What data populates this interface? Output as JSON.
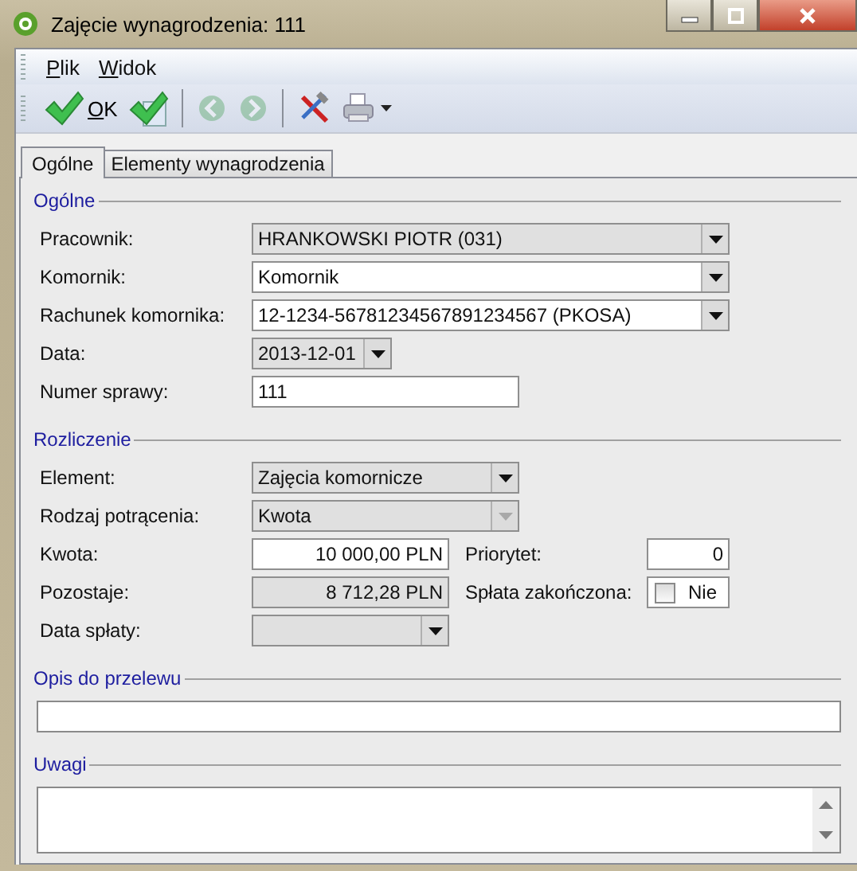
{
  "window": {
    "title": "Zajęcie wynagrodzenia: 111"
  },
  "menu": [
    {
      "key": "P",
      "rest": "lik"
    },
    {
      "key": "W",
      "rest": "idok"
    }
  ],
  "toolbar": [
    {
      "kind": "ok",
      "key": "O",
      "rest": "K",
      "disabled": false
    },
    {
      "kind": "save-new",
      "disabled": false
    },
    {
      "kind": "separator"
    },
    {
      "kind": "back",
      "disabled": true
    },
    {
      "kind": "forward",
      "disabled": true
    },
    {
      "kind": "separator"
    },
    {
      "kind": "tools",
      "disabled": false
    },
    {
      "kind": "print",
      "disabled": false
    }
  ],
  "tabs": [
    {
      "label": "Ogólne",
      "selected": true
    },
    {
      "label": "Elementy wynagrodzenia",
      "selected": false
    }
  ],
  "sections": [
    {
      "title": "Ogólne",
      "kind": "form",
      "rows": [
        {
          "fields": [
            {
              "label": "Pracownik:",
              "kind": "combo",
              "value": "HRANKOWSKI PIOTR (031)",
              "readonly": true,
              "disabled": false
            }
          ]
        },
        {
          "fields": [
            {
              "label": "Komornik:",
              "kind": "combo",
              "value": "Komornik",
              "readonly": false,
              "disabled": false
            }
          ]
        },
        {
          "fields": [
            {
              "label": "Rachunek komornika:",
              "kind": "combo",
              "value": "12-1234-56781234567891234567 (PKOSA)",
              "readonly": false,
              "disabled": false
            }
          ]
        },
        {
          "fields": [
            {
              "label": "Data:",
              "kind": "combo",
              "value": "2013-12-01",
              "readonly": true,
              "disabled": false
            }
          ]
        },
        {
          "fields": [
            {
              "label": "Numer sprawy:",
              "kind": "text",
              "value": "111",
              "readonly": false
            }
          ]
        }
      ]
    },
    {
      "title": "Rozliczenie",
      "kind": "form",
      "rows": [
        {
          "fields": [
            {
              "label": "Element:",
              "kind": "combo",
              "value": "Zajęcia komornicze",
              "readonly": true,
              "disabled": false
            }
          ]
        },
        {
          "fields": [
            {
              "label": "Rodzaj potrącenia:",
              "kind": "combo",
              "value": "Kwota",
              "readonly": true,
              "disabled": true
            }
          ]
        },
        {
          "fields": [
            {
              "label": "Kwota:",
              "kind": "amount",
              "value": "10 000,00 PLN",
              "readonly": false
            },
            {
              "label": "Priorytet:",
              "kind": "amount",
              "value": "0",
              "readonly": false
            }
          ]
        },
        {
          "fields": [
            {
              "label": "Pozostaje:",
              "kind": "amount",
              "value": "8 712,28 PLN",
              "readonly": true
            },
            {
              "label": "Spłata zakończona:",
              "kind": "check",
              "checked": false,
              "value": "Nie"
            }
          ]
        },
        {
          "fields": [
            {
              "label": "Data spłaty:",
              "kind": "combo",
              "readonly": true,
              "disabled": false
            }
          ]
        }
      ]
    },
    {
      "title": "Opis do przelewu",
      "kind": "line"
    },
    {
      "title": "Uwagi",
      "kind": "memo"
    }
  ]
}
